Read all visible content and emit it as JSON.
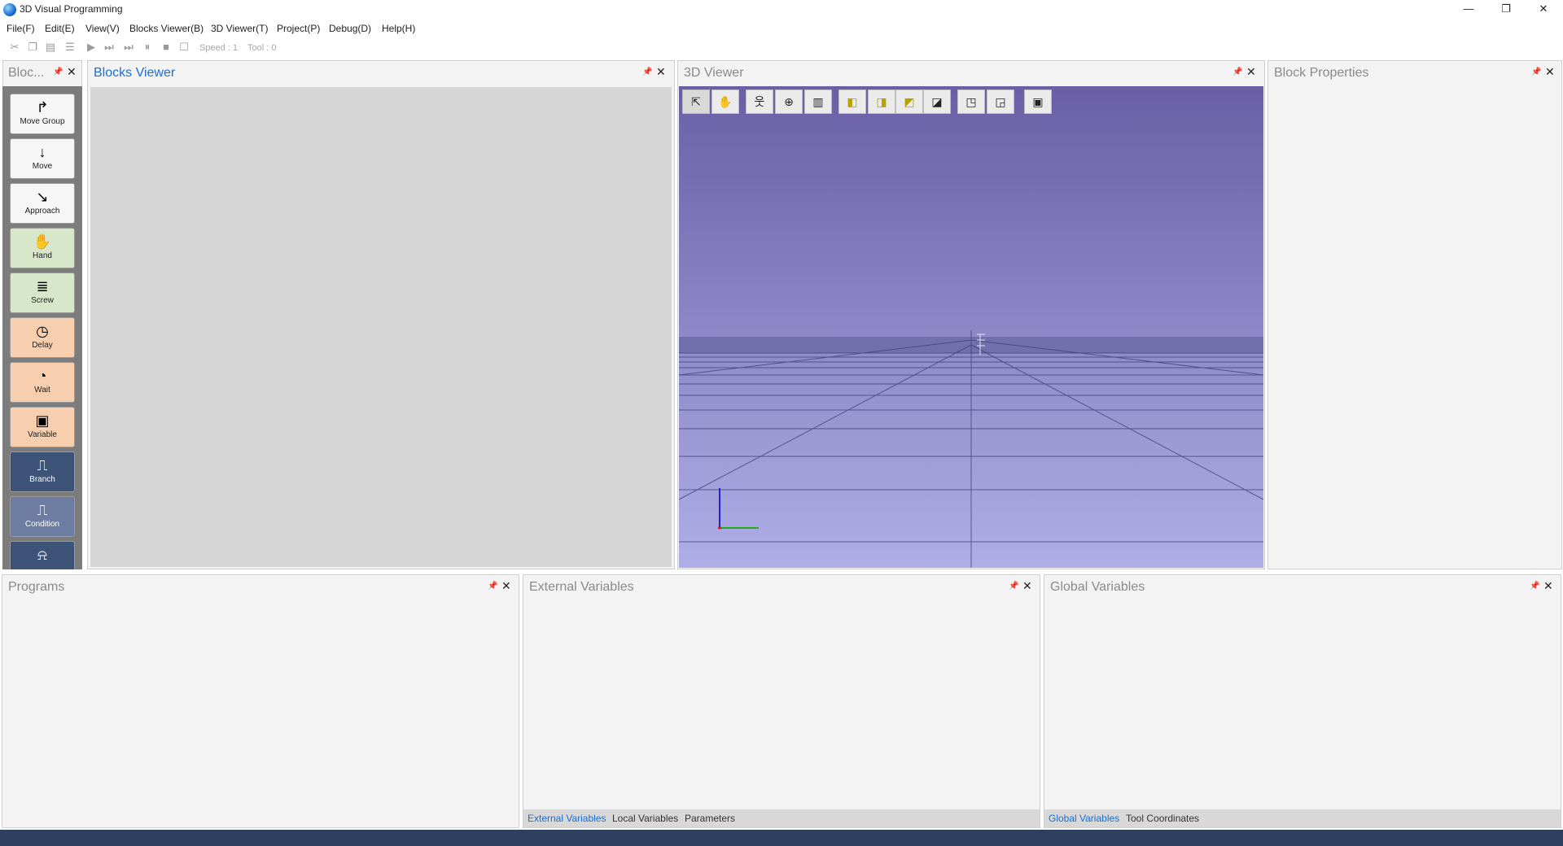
{
  "window": {
    "title": "3D Visual Programming",
    "minimize": "—",
    "restore": "❐",
    "close": "✕"
  },
  "menu": [
    "File(F)",
    "Edit(E)",
    "View(V)",
    "Blocks Viewer(B)",
    "3D Viewer(T)",
    "Project(P)",
    "Debug(D)",
    "Help(H)"
  ],
  "toolbar": {
    "speed": "Speed : 1",
    "tool": "Tool : 0"
  },
  "palette": {
    "title": "Bloc...",
    "blocks": [
      {
        "label": "Move Group",
        "icon": "↱",
        "color": "white"
      },
      {
        "label": "Move",
        "icon": "↓",
        "color": "white"
      },
      {
        "label": "Approach",
        "icon": "↘",
        "color": "white"
      },
      {
        "label": "Hand",
        "icon": "✋",
        "color": "green"
      },
      {
        "label": "Screw",
        "icon": "≣",
        "color": "green"
      },
      {
        "label": "Delay",
        "icon": "◷",
        "color": "orange"
      },
      {
        "label": "Wait",
        "icon": "◔",
        "color": "orange"
      },
      {
        "label": "Variable",
        "icon": "▣",
        "color": "orange"
      },
      {
        "label": "Branch",
        "icon": "⎍",
        "color": "blue"
      },
      {
        "label": "Condition",
        "icon": "⎍",
        "color": "ltblue"
      },
      {
        "label": "",
        "icon": "⍾",
        "color": "blue"
      }
    ]
  },
  "blocks_viewer": {
    "title": "Blocks Viewer"
  },
  "viewer3d": {
    "title": "3D Viewer"
  },
  "block_properties": {
    "title": "Block Properties"
  },
  "programs": {
    "title": "Programs"
  },
  "external_variables": {
    "title": "External Variables",
    "tabs": [
      "External Variables",
      "Local Variables",
      "Parameters"
    ],
    "active_tab": 0
  },
  "global_variables": {
    "title": "Global Variables",
    "tabs": [
      "Global Variables",
      "Tool Coordinates"
    ],
    "active_tab": 0
  },
  "colors": {
    "accent": "#1a6fd1",
    "sky_top": "#6a5fa5",
    "sky_bottom": "#afaee6",
    "status_bar": "#2f3f5f"
  }
}
